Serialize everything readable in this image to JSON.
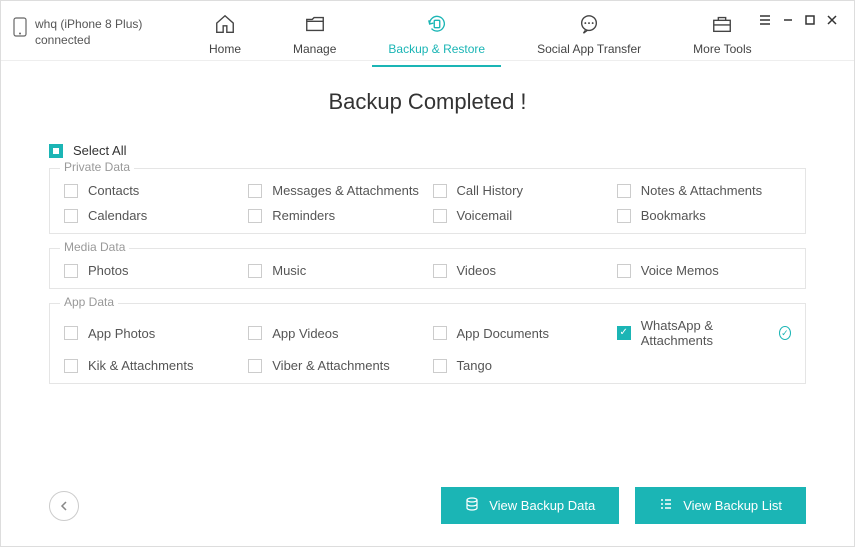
{
  "device": {
    "name": "whq (iPhone 8 Plus)",
    "status": "connected"
  },
  "nav": {
    "home": "Home",
    "manage": "Manage",
    "backup_restore": "Backup & Restore",
    "social": "Social App Transfer",
    "more": "More Tools"
  },
  "title": "Backup Completed !",
  "select_all_label": "Select All",
  "groups": {
    "private": {
      "label": "Private Data",
      "items": {
        "contacts": "Contacts",
        "messages": "Messages & Attachments",
        "call_history": "Call History",
        "notes": "Notes & Attachments",
        "calendars": "Calendars",
        "reminders": "Reminders",
        "voicemail": "Voicemail",
        "bookmarks": "Bookmarks"
      }
    },
    "media": {
      "label": "Media Data",
      "items": {
        "photos": "Photos",
        "music": "Music",
        "videos": "Videos",
        "voice_memos": "Voice Memos"
      }
    },
    "app": {
      "label": "App Data",
      "items": {
        "app_photos": "App Photos",
        "app_videos": "App Videos",
        "app_documents": "App Documents",
        "whatsapp": "WhatsApp & Attachments",
        "kik": "Kik & Attachments",
        "viber": "Viber & Attachments",
        "tango": "Tango"
      }
    }
  },
  "buttons": {
    "view_backup_data": "View Backup Data",
    "view_backup_list": "View Backup List"
  },
  "colors": {
    "accent": "#1bb5b5"
  }
}
